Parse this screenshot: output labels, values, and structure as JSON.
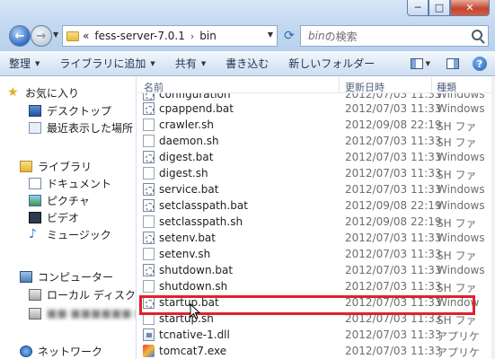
{
  "window": {
    "minimize_label": "─",
    "maximize_label": "□",
    "close_label": "✕"
  },
  "address": {
    "overflow_label": "«",
    "crumbs": [
      "fess-server-7.0.1",
      "bin"
    ],
    "separator": "›"
  },
  "search": {
    "placeholder_prefix": "bin",
    "placeholder_suffix": "の検索"
  },
  "toolbar": {
    "organize": "整理",
    "add_to_library": "ライブラリに追加",
    "share": "共有",
    "burn": "書き込む",
    "new_folder": "新しいフォルダー",
    "help": "?"
  },
  "nav": {
    "favorites": "お気に入り",
    "desktop": "デスクトップ",
    "recent": "最近表示した場所",
    "libraries": "ライブラリ",
    "documents": "ドキュメント",
    "pictures": "ピクチャ",
    "videos": "ビデオ",
    "music": "ミュージック",
    "computer": "コンピューター",
    "local_disk": "ローカル ディスク (",
    "blurred_drive": "■■ ■■■■■■ ■■",
    "network": "ネットワーク"
  },
  "columns": {
    "name": "名前",
    "modified": "更新日時",
    "type": "種類"
  },
  "files": [
    {
      "name": "configuration",
      "date": "2012/07/03 11:33",
      "type": "Windows",
      "icon": "bat"
    },
    {
      "name": "cpappend.bat",
      "date": "2012/07/03 11:33",
      "type": "Windows",
      "icon": "bat"
    },
    {
      "name": "crawler.sh",
      "date": "2012/09/08 22:19",
      "type": "SH ファ",
      "icon": "sh"
    },
    {
      "name": "daemon.sh",
      "date": "2012/07/03 11:33",
      "type": "SH ファ",
      "icon": "sh"
    },
    {
      "name": "digest.bat",
      "date": "2012/07/03 11:33",
      "type": "Windows",
      "icon": "bat"
    },
    {
      "name": "digest.sh",
      "date": "2012/07/03 11:33",
      "type": "SH ファ",
      "icon": "sh"
    },
    {
      "name": "service.bat",
      "date": "2012/07/03 11:33",
      "type": "Windows",
      "icon": "bat"
    },
    {
      "name": "setclasspath.bat",
      "date": "2012/09/08 22:19",
      "type": "Windows",
      "icon": "bat"
    },
    {
      "name": "setclasspath.sh",
      "date": "2012/09/08 22:19",
      "type": "SH ファ",
      "icon": "sh"
    },
    {
      "name": "setenv.bat",
      "date": "2012/07/03 11:33",
      "type": "Windows",
      "icon": "bat"
    },
    {
      "name": "setenv.sh",
      "date": "2012/07/03 11:33",
      "type": "SH ファ",
      "icon": "sh"
    },
    {
      "name": "shutdown.bat",
      "date": "2012/07/03 11:33",
      "type": "Windows",
      "icon": "bat"
    },
    {
      "name": "shutdown.sh",
      "date": "2012/07/03 11:33",
      "type": "SH ファ",
      "icon": "sh"
    },
    {
      "name": "startup.bat",
      "date": "2012/07/03 11:33",
      "type": "Window",
      "icon": "bat"
    },
    {
      "name": "startup.sh",
      "date": "2012/07/03 11:33",
      "type": "SH ファ",
      "icon": "sh"
    },
    {
      "name": "tcnative-1.dll",
      "date": "2012/07/03 11:33",
      "type": "アプリケ",
      "icon": "dll"
    },
    {
      "name": "tomcat7.exe",
      "date": "2012/07/03 11:33",
      "type": "アプリケ",
      "icon": "exe"
    }
  ],
  "highlighted_file": "startup.bat"
}
